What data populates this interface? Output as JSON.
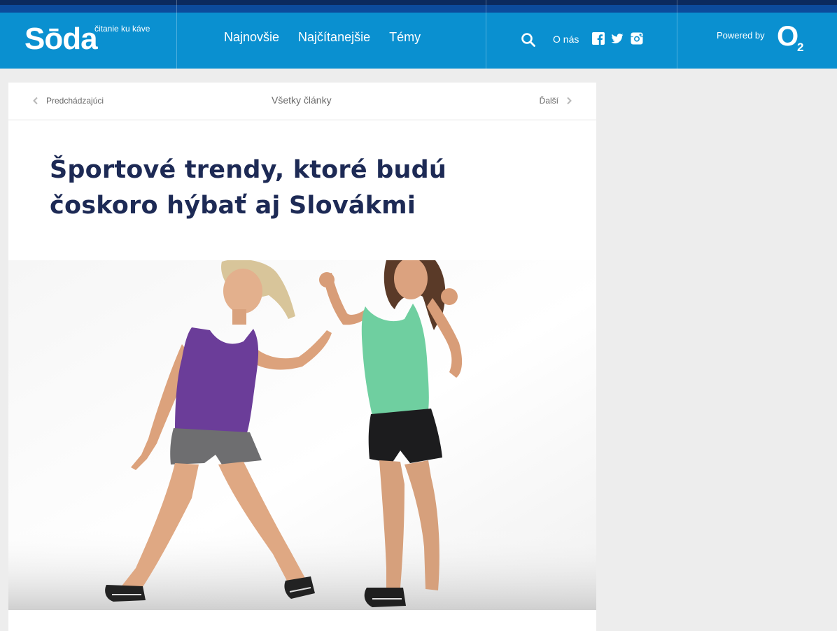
{
  "brand": {
    "logo_text": "Sōda",
    "tagline": "čitanie ku káve",
    "colors": {
      "header": "#0a90d0",
      "topstrip": "#0b2a5e",
      "title": "#1d2a55",
      "page_bg": "#ededed"
    }
  },
  "nav": {
    "items": [
      {
        "label": "Najnovšie"
      },
      {
        "label": "Najčítanejšie"
      },
      {
        "label": "Témy"
      }
    ]
  },
  "utility": {
    "search_icon": "search-icon",
    "about_label": "O nás",
    "social": [
      "facebook-icon",
      "twitter-icon",
      "instagram-icon"
    ]
  },
  "sponsor": {
    "powered_label": "Powered by",
    "o2_letter": "O",
    "o2_sub": "2"
  },
  "article_nav": {
    "prev_label": "Predchádzajúci",
    "all_label": "Všetky články",
    "next_label": "Ďalší"
  },
  "article": {
    "title": "Športové trendy, ktoré budú čoskoro hýbať aj Slovákmi",
    "hero_image": "photo of two women dancing in sportswear"
  }
}
